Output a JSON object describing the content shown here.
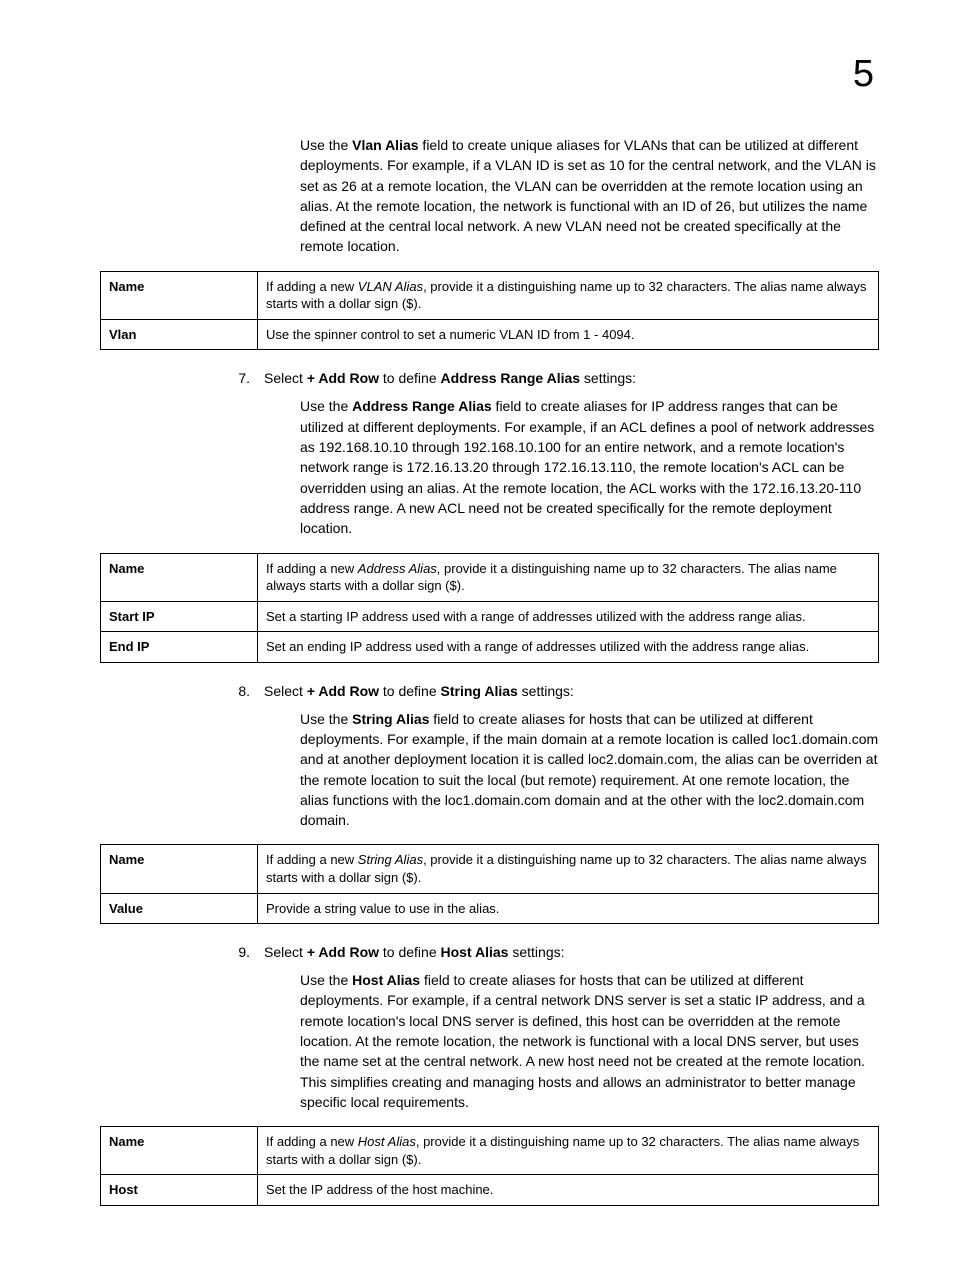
{
  "page": {
    "chapter_number": "5",
    "vlan_intro": {
      "pre": "Use the ",
      "label": "Vlan Alias",
      "post": " field to create unique aliases for VLANs that can be utilized at different deployments. For example, if a VLAN ID is set as 10 for the central network, and the VLAN is set as 26 at a remote location, the VLAN can be overridden at the remote location using an alias. At the remote location, the network is functional with an ID of 26, but utilizes the name defined at the central local network. A new VLAN need not be created specifically at the remote location."
    },
    "vlan_table": {
      "name_key": "Name",
      "name_val_pre": "If adding a new ",
      "name_val_em": "VLAN Alias",
      "name_val_post": ", provide it a distinguishing name up to 32 characters. The alias name always starts with a dollar sign ($).",
      "vlan_key": "Vlan",
      "vlan_val": "Use the spinner control to set a numeric VLAN ID from 1 - 4094."
    },
    "step7": {
      "num": "7.",
      "pre": "Select ",
      "b1": "+ Add Row",
      "mid": " to define ",
      "b2": "Address Range Alias",
      "post": " settings:"
    },
    "addr_intro": {
      "pre": "Use the ",
      "label": "Address Range Alias",
      "post": " field to create aliases for IP address ranges that can be utilized at different deployments. For example, if an ACL defines a pool of network addresses as 192.168.10.10 through 192.168.10.100 for an entire network, and a remote location's network range is 172.16.13.20 through 172.16.13.110, the remote location's ACL can be overridden using an alias. At the remote location, the ACL works with the 172.16.13.20-110 address range. A new ACL need not be created specifically for the remote deployment location."
    },
    "addr_table": {
      "name_key": "Name",
      "name_val_pre": "If adding a new ",
      "name_val_em": "Address Alias",
      "name_val_post": ", provide it a distinguishing name up to 32 characters. The alias name always starts with a dollar sign ($).",
      "start_key": "Start IP",
      "start_val": "Set a starting IP address used with a range of addresses utilized with the address range alias.",
      "end_key": "End IP",
      "end_val": "Set an ending IP address used with a range of addresses utilized with the address range alias."
    },
    "step8": {
      "num": "8.",
      "pre": "Select ",
      "b1": "+ Add Row",
      "mid": " to define ",
      "b2": "String Alias",
      "post": " settings:"
    },
    "string_intro": {
      "pre": "Use the ",
      "label": "String Alias",
      "post": " field to create aliases for hosts that can be utilized at different deployments. For example, if the main domain at a remote location is called loc1.domain.com and at another deployment location it is called loc2.domain.com, the alias can be overriden at the remote location to suit the local (but remote) requirement. At one remote location, the alias functions with the loc1.domain.com domain and at the other with the loc2.domain.com domain."
    },
    "string_table": {
      "name_key": "Name",
      "name_val_pre": "If adding a new ",
      "name_val_em": "String Alias",
      "name_val_post": ", provide it a distinguishing name up to 32 characters. The alias name always starts with a dollar sign ($).",
      "value_key": "Value",
      "value_val": "Provide a string value to use in the alias."
    },
    "step9": {
      "num": "9.",
      "pre": "Select ",
      "b1": "+ Add Row",
      "mid": " to define ",
      "b2": "Host Alias",
      "post": " settings:"
    },
    "host_intro": {
      "pre": "Use the ",
      "label": "Host Alias",
      "post": " field to create aliases for hosts that can be utilized at different deployments. For example, if a central network DNS server is set a static IP address, and a remote location's local DNS server is defined, this host can be overridden at the remote location. At the remote location, the network is functional with a local DNS server, but uses the name set at the central network. A new host need not be created at the remote location. This simplifies creating and managing hosts and allows an administrator to better manage specific local requirements."
    },
    "host_table": {
      "name_key": "Name",
      "name_val_pre": "If adding a new ",
      "name_val_em": "Host Alias",
      "name_val_post": ", provide it a distinguishing name up to 32 characters. The alias name always starts with a dollar sign ($).",
      "host_key": "Host",
      "host_val": "Set the IP address of the host machine."
    }
  }
}
